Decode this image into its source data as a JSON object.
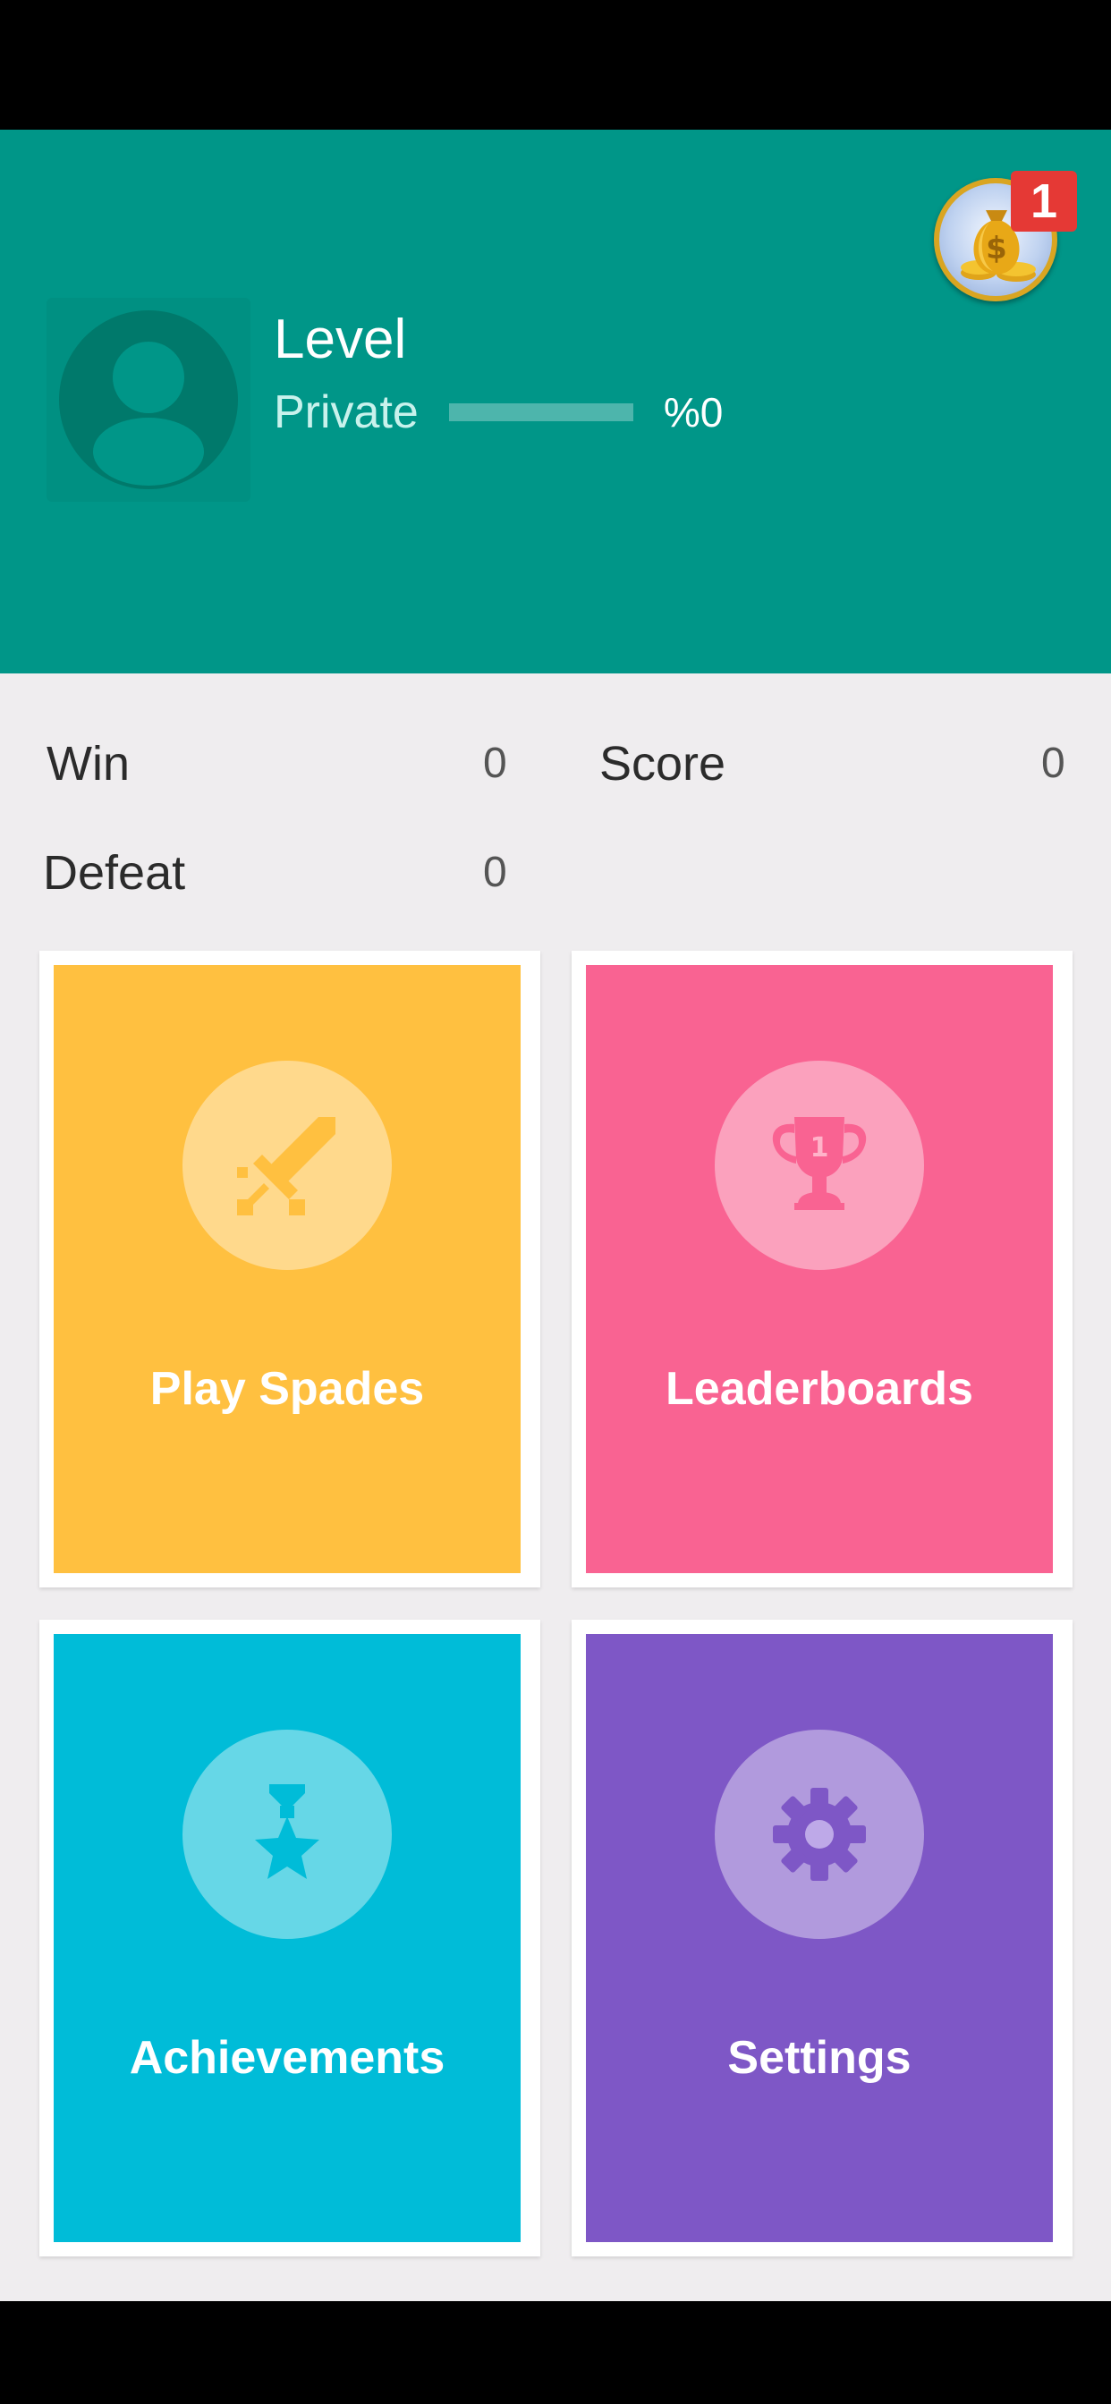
{
  "profile": {
    "level_title": "Level",
    "rank": "Private",
    "progress_percent": 0,
    "progress_text": "%0"
  },
  "coins": {
    "icon": "money-bag-icon",
    "badge_count": "1"
  },
  "stats": {
    "win_label": "Win",
    "win_value": "0",
    "score_label": "Score",
    "score_value": "0",
    "defeat_label": "Defeat",
    "defeat_value": "0"
  },
  "tiles": [
    {
      "label": "Play Spades",
      "icon": "sword-icon",
      "color": "#FFC040"
    },
    {
      "label": "Leaderboards",
      "icon": "trophy-icon",
      "color": "#F96392"
    },
    {
      "label": "Achievements",
      "icon": "medal-icon",
      "color": "#00BCD8"
    },
    {
      "label": "Settings",
      "icon": "gear-icon",
      "color": "#7E57C6"
    }
  ],
  "colors": {
    "header": "#009688",
    "avatar": "#00796B",
    "background": "#EFEDEF"
  }
}
